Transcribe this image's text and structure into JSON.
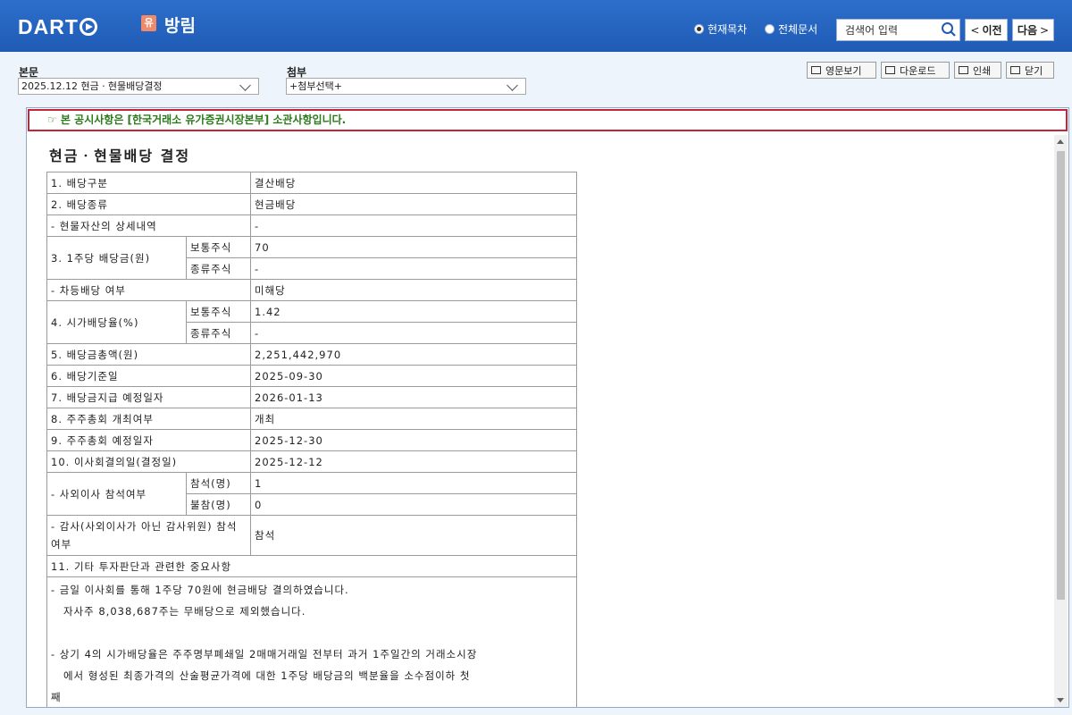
{
  "header": {
    "logo_text": "DART",
    "market_badge": "유",
    "company_name": "방림",
    "scope_current": "현재목차",
    "scope_all": "전체문서",
    "search_placeholder": "검색어 입력",
    "prev_label": "이전",
    "next_label": "다음",
    "colors": {
      "bar": "#1f5bb5",
      "badge": "#f08a6a"
    }
  },
  "toolbar": {
    "main_label": "본문",
    "main_select": "2025.12.12  현금ㆍ현물배당결정",
    "attach_label": "첨부",
    "attach_select": "+첨부선택+",
    "btn_english": "영문보기",
    "btn_download": "다운로드",
    "btn_print": "인쇄",
    "btn_close": "닫기"
  },
  "notice": "☞ 본 공시사항은 [한국거래소 유가증권시장본부] 소관사항입니다.",
  "document": {
    "title": "현금ㆍ현물배당 결정",
    "r1_label": "1. 배당구분",
    "r1_value": "결산배당",
    "r2_label": "2. 배당종류",
    "r2_value": "현금배당",
    "r2a_label": "- 현물자산의 상세내역",
    "r2a_value": "-",
    "r3_label": "3. 1주당 배당금(원)",
    "r3_common_label": "보통주식",
    "r3_common_value": "70",
    "r3_class_label": "종류주식",
    "r3_class_value": "-",
    "r3a_label": "- 차등배당 여부",
    "r3a_value": "미해당",
    "r4_label": "4. 시가배당율(%)",
    "r4_common_label": "보통주식",
    "r4_common_value": "1.42",
    "r4_class_label": "종류주식",
    "r4_class_value": "-",
    "r5_label": "5. 배당금총액(원)",
    "r5_value": "2,251,442,970",
    "r6_label": "6. 배당기준일",
    "r6_value": "2025-09-30",
    "r7_label": "7. 배당금지급 예정일자",
    "r7_value": "2026-01-13",
    "r8_label": "8. 주주총회 개최여부",
    "r8_value": "개최",
    "r9_label": "9. 주주총회 예정일자",
    "r9_value": "2025-12-30",
    "r10_label": "10. 이사회결의일(결정일)",
    "r10_value": "2025-12-12",
    "r10a_label": "- 사외이사 참석여부",
    "r10a_present_label": "참석(명)",
    "r10a_present_value": "1",
    "r10a_absent_label": "불참(명)",
    "r10a_absent_value": "0",
    "r10b_label": "- 감사(사외이사가 아닌 감사위원) 참석여부",
    "r10b_value": "참석",
    "r11_label": "11. 기타 투자판단과 관련한 중요사항",
    "r11_note": "- 금일 이사회를 통해 1주당 70원에 현금배당 결의하였습니다.\n   자사주 8,038,687주는 무배당으로 제외했습니다.\n\n- 상기 4의 시가배당율은 주주명부폐쇄일 2매매거래일 전부터 과거 1주일간의 거래소시장\n   에서 형성된 최종가격의 산술평균가격에 대한 1주당 배당금의 백분율을 소수점이하 첫\n째\n   자리까지 기재하였습니다."
  }
}
